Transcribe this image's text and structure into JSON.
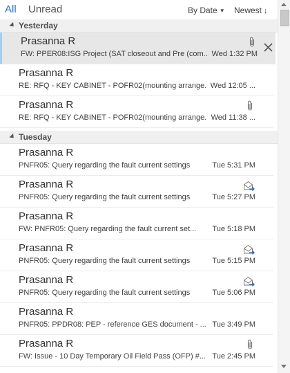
{
  "filters": {
    "all": "All",
    "unread": "Unread"
  },
  "sort": {
    "by": "By Date",
    "order": "Newest"
  },
  "colors": {
    "accent": "#2b6cb6",
    "selected_bg": "#e7e7e7",
    "selected_bar": "#a9cdec"
  },
  "groups": [
    {
      "label": "Yesterday"
    },
    {
      "label": "Tuesday"
    }
  ],
  "messages": [
    {
      "sender": "Prasanna R",
      "subject": "FW: PPER08:ISG Project (SAT closeout and Pre (com...",
      "time": "Wed 1:32 PM",
      "icon": "paperclip-icon",
      "selected": true
    },
    {
      "sender": "Prasanna R",
      "subject": "RE: RFQ - KEY CABINET - POFR02(mounting arrange...",
      "time": "Wed 12:05 ...",
      "icon": ""
    },
    {
      "sender": "Prasanna R",
      "subject": "RE: RFQ - KEY CABINET - POFR02(mounting arrange...",
      "time": "Wed 11:38 ...",
      "icon": "paperclip-icon"
    },
    {
      "sender": "Prasanna R",
      "subject": "PNFR05: Query regarding the fault current settings",
      "time": "Tue 5:31 PM",
      "icon": ""
    },
    {
      "sender": "Prasanna R",
      "subject": "PNFR05: Query regarding the fault current settings",
      "time": "Tue 5:27 PM",
      "icon": "forwarded-icon"
    },
    {
      "sender": "Prasanna R",
      "subject": "FW: PNFR05: Query regarding the fault current set...",
      "time": "Tue 5:18 PM",
      "icon": ""
    },
    {
      "sender": "Prasanna R",
      "subject": "PNFR05: Query regarding the fault current settings",
      "time": "Tue 5:15 PM",
      "icon": "forwarded-icon"
    },
    {
      "sender": "Prasanna R",
      "subject": "PNFR05: Query regarding the fault current settings",
      "time": "Tue 5:06 PM",
      "icon": "forwarded-icon"
    },
    {
      "sender": "Prasanna R",
      "subject": "PNFR05: PPDR08: PEP - reference GES document - ...",
      "time": "Tue 3:49 PM",
      "icon": ""
    },
    {
      "sender": "Prasanna R",
      "subject": "FW: Issue - 10 Day Temporary Oil Field Pass (OFP) #...",
      "time": "Tue 2:45 PM",
      "icon": "paperclip-icon"
    }
  ]
}
